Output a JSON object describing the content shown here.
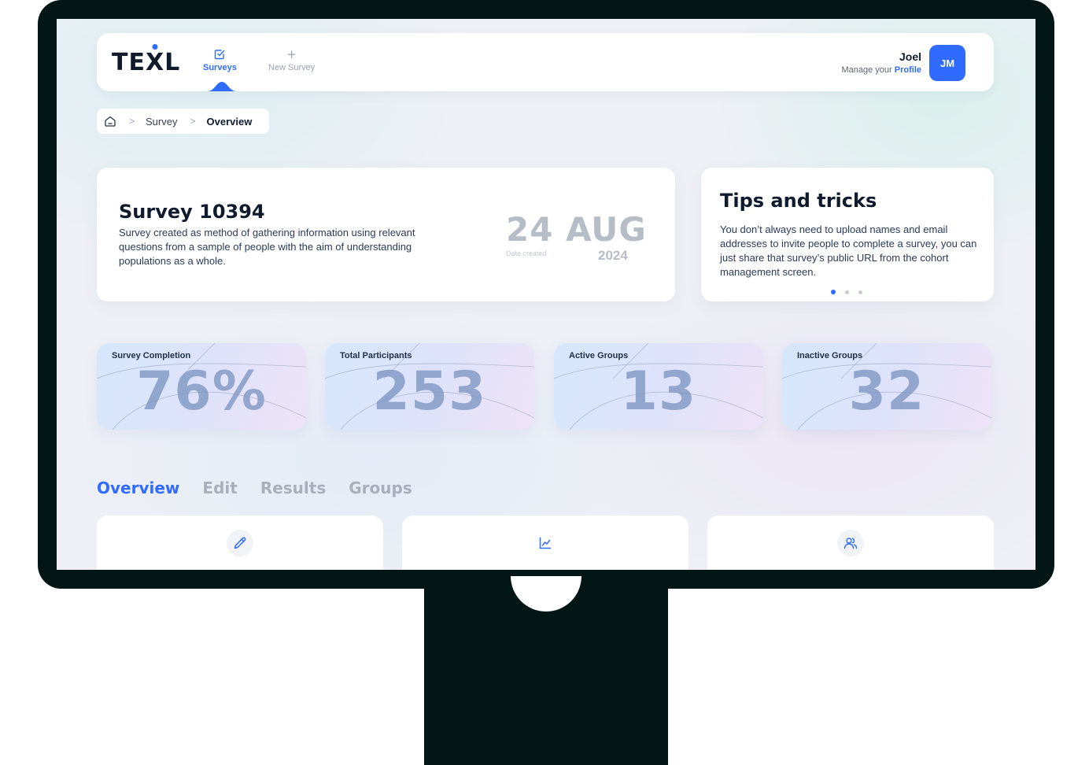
{
  "app": {
    "logo_text_pre": "TE",
    "logo_text_x": "X",
    "logo_text_post": "L",
    "accent_color": "#2f6bff"
  },
  "nav": {
    "surveys_label": "Surveys",
    "new_survey_label": "New Survey",
    "surveys_icon": "check-square-icon",
    "new_survey_icon": "plus-icon"
  },
  "profile": {
    "name": "Joel",
    "manage_prefix": "Manage your",
    "manage_link": "Profile",
    "initials": "JM"
  },
  "breadcrumb": {
    "home_icon": "home-icon",
    "items": [
      "Survey",
      "Overview"
    ]
  },
  "survey": {
    "title": "Survey 10394",
    "description": "Survey created as method of gathering information using relevant questions from a sample of people with the aim of understanding populations as a whole.",
    "date_day_month": "24 AUG",
    "date_label": "Date created",
    "date_year": "2024"
  },
  "tips": {
    "title": "Tips and tricks",
    "body": "You don’t always need to upload names and email addresses to invite people to complete a survey, you can just share that survey’s public URL from the cohort management screen.",
    "page_count": 3,
    "active_page": 1
  },
  "stats": [
    {
      "label": "Survey Completion",
      "value": "76%"
    },
    {
      "label": "Total Participants",
      "value": "253"
    },
    {
      "label": "Active Groups",
      "value": "13"
    },
    {
      "label": "Inactive Groups",
      "value": "32"
    }
  ],
  "tabs": [
    "Overview",
    "Edit",
    "Results",
    "Groups"
  ],
  "active_tab": "Overview",
  "action_cards": [
    {
      "icon": "pencil-icon"
    },
    {
      "icon": "chart-line-icon"
    },
    {
      "icon": "users-icon"
    }
  ]
}
